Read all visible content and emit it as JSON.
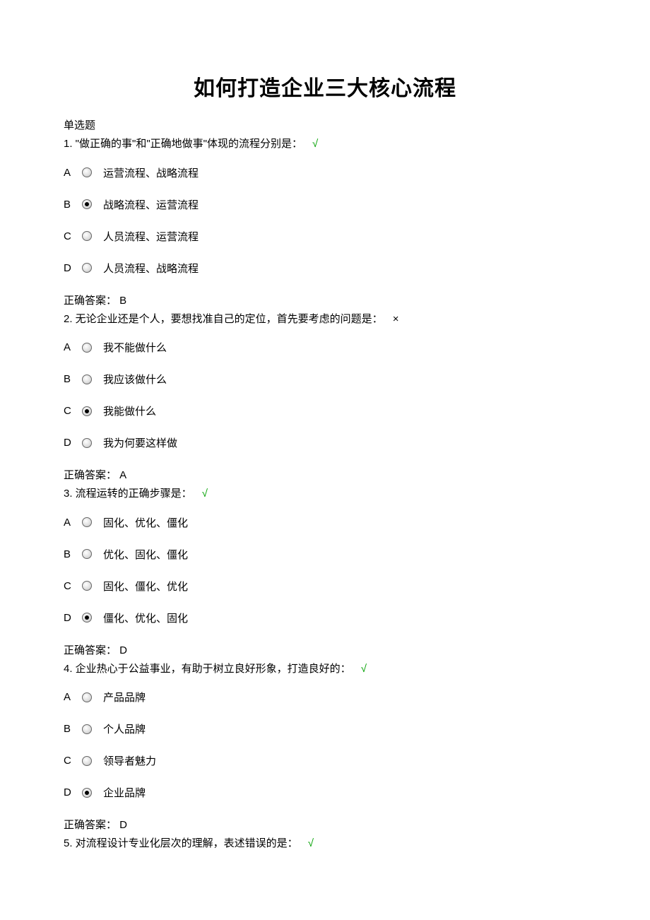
{
  "title": "如何打造企业三大核心流程",
  "section_label": "单选题",
  "answer_prefix": "正确答案：",
  "questions": [
    {
      "number": "1.",
      "text": "\"做正确的事\"和\"正确地做事\"体现的流程分别是：",
      "mark": "√",
      "mark_correct": true,
      "options": [
        {
          "letter": "A",
          "text": "运营流程、战略流程",
          "selected": false
        },
        {
          "letter": "B",
          "text": "战略流程、运营流程",
          "selected": true
        },
        {
          "letter": "C",
          "text": "人员流程、运营流程",
          "selected": false
        },
        {
          "letter": "D",
          "text": "人员流程、战略流程",
          "selected": false
        }
      ],
      "answer": "B"
    },
    {
      "number": "2.",
      "text": "无论企业还是个人，要想找准自己的定位，首先要考虑的问题是：",
      "mark": "×",
      "mark_correct": false,
      "options": [
        {
          "letter": "A",
          "text": "我不能做什么",
          "selected": false
        },
        {
          "letter": "B",
          "text": "我应该做什么",
          "selected": false
        },
        {
          "letter": "C",
          "text": "我能做什么",
          "selected": true
        },
        {
          "letter": "D",
          "text": "我为何要这样做",
          "selected": false
        }
      ],
      "answer": "A"
    },
    {
      "number": "3.",
      "text": "流程运转的正确步骤是：",
      "mark": "√",
      "mark_correct": true,
      "options": [
        {
          "letter": "A",
          "text": "固化、优化、僵化",
          "selected": false
        },
        {
          "letter": "B",
          "text": "优化、固化、僵化",
          "selected": false
        },
        {
          "letter": "C",
          "text": "固化、僵化、优化",
          "selected": false
        },
        {
          "letter": "D",
          "text": "僵化、优化、固化",
          "selected": true
        }
      ],
      "answer": "D"
    },
    {
      "number": "4.",
      "text": "企业热心于公益事业，有助于树立良好形象，打造良好的：",
      "mark": "√",
      "mark_correct": true,
      "options": [
        {
          "letter": "A",
          "text": "产品品牌",
          "selected": false
        },
        {
          "letter": "B",
          "text": "个人品牌",
          "selected": false
        },
        {
          "letter": "C",
          "text": "领导者魅力",
          "selected": false
        },
        {
          "letter": "D",
          "text": "企业品牌",
          "selected": true
        }
      ],
      "answer": "D"
    },
    {
      "number": "5.",
      "text": "对流程设计专业化层次的理解，表述错误的是：",
      "mark": "√",
      "mark_correct": true,
      "options": [],
      "answer": null
    }
  ]
}
